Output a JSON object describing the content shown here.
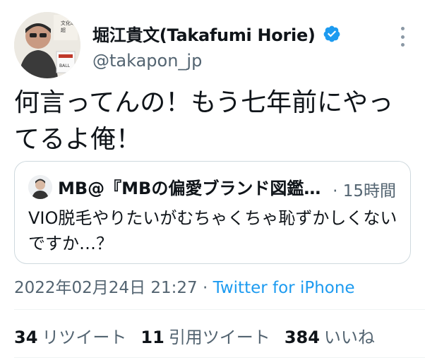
{
  "author": {
    "display_name": "堀江貴文(Takafumi Horie)",
    "handle": "@takapon_jp",
    "avatar_text": "堀江貴文 文化の超"
  },
  "tweet": {
    "text": "何言ってんの！もう七年前にやってるよ俺！"
  },
  "quote": {
    "name": "MB@『MBの偏愛ブランド図鑑…",
    "time": "· 15時間",
    "text": "VIO脱毛やりたいがむちゃくちゃ恥ずかしくないですか…？"
  },
  "meta": {
    "timestamp": "2022年02月24日 21:27",
    "separator": " · ",
    "source": "Twitter for iPhone"
  },
  "stats": {
    "retweets_count": "34",
    "retweets_label": "リツイート",
    "quotes_count": "11",
    "quotes_label": "引用ツイート",
    "likes_count": "384",
    "likes_label": "いいね"
  },
  "colors": {
    "verified": "#1d9bf0",
    "link": "#1d9bf0",
    "secondary_text": "#536471"
  },
  "icons": [
    "verified-badge-icon",
    "more-options-icon"
  ]
}
